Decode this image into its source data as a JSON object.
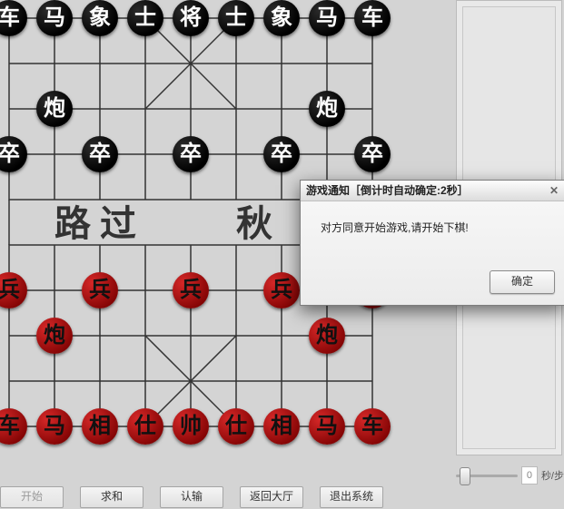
{
  "board": {
    "river_left": "路 过",
    "river_right": "秋",
    "pieces": {
      "black": {
        "back_rank": [
          "车",
          "马",
          "象",
          "士",
          "将",
          "士",
          "象",
          "马",
          "车"
        ],
        "cannon": "炮",
        "soldier": "卒"
      },
      "red": {
        "back_rank": [
          "车",
          "马",
          "相",
          "仕",
          "帅",
          "仕",
          "相",
          "马",
          "车"
        ],
        "cannon": "炮",
        "soldier": "兵"
      }
    }
  },
  "buttons": {
    "start": "开始",
    "draw": "求和",
    "resign": "认输",
    "lobby": "返回大厅",
    "exit": "退出系统"
  },
  "time": {
    "value": "0",
    "unit": "秒/步"
  },
  "dialog": {
    "title": "游戏通知［倒计时自动确定:2秒］",
    "message": "对方同意开始游戏,请开始下棋!",
    "ok": "确定",
    "close_glyph": "✕"
  }
}
